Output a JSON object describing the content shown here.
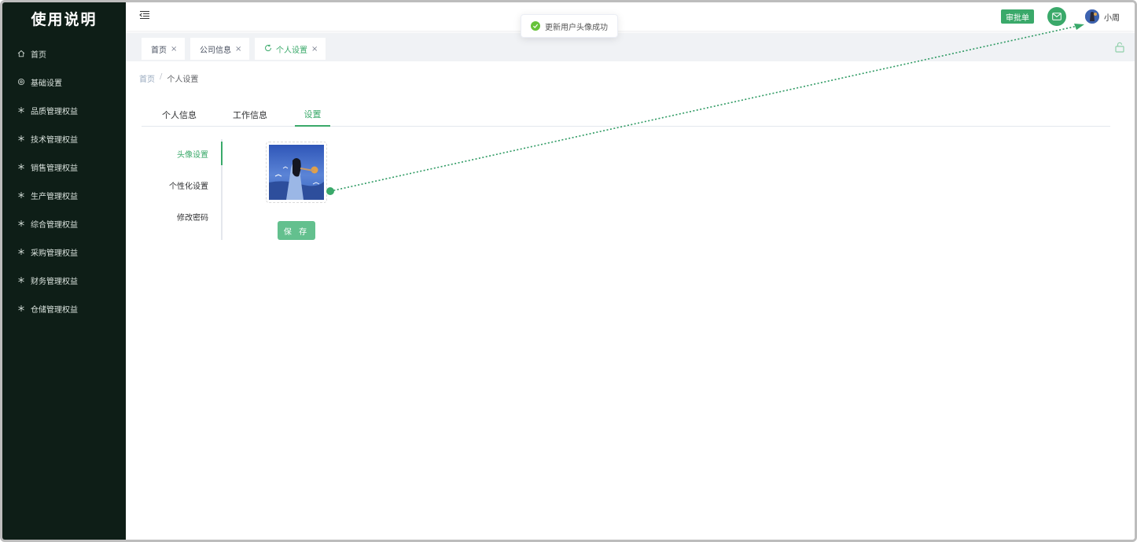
{
  "sidebar": {
    "title": "使用说明",
    "items": [
      {
        "label": "首页",
        "icon": "home-icon"
      },
      {
        "label": "基础设置",
        "icon": "settings-icon"
      },
      {
        "label": "品质管理权益",
        "icon": "asterisk-icon"
      },
      {
        "label": "技术管理权益",
        "icon": "asterisk-icon"
      },
      {
        "label": "销售管理权益",
        "icon": "asterisk-icon"
      },
      {
        "label": "生产管理权益",
        "icon": "asterisk-icon"
      },
      {
        "label": "综合管理权益",
        "icon": "asterisk-icon"
      },
      {
        "label": "采购管理权益",
        "icon": "asterisk-icon"
      },
      {
        "label": "财务管理权益",
        "icon": "asterisk-icon"
      },
      {
        "label": "仓储管理权益",
        "icon": "asterisk-icon"
      }
    ]
  },
  "header": {
    "approve_label": "审批单",
    "user_name": "小周"
  },
  "toast": {
    "message": "更新用户头像成功",
    "status_color": "#67c23a"
  },
  "tags": [
    {
      "label": "首页",
      "active": false
    },
    {
      "label": "公司信息",
      "active": false
    },
    {
      "label": "个人设置",
      "active": true
    }
  ],
  "breadcrumb": {
    "home": "首页",
    "separator": "/",
    "current": "个人设置"
  },
  "top_tabs": [
    {
      "label": "个人信息",
      "active": false
    },
    {
      "label": "工作信息",
      "active": false
    },
    {
      "label": "设置",
      "active": true
    }
  ],
  "side_tabs": [
    {
      "label": "头像设置",
      "active": true
    },
    {
      "label": "个性化设置",
      "active": false
    },
    {
      "label": "修改密码",
      "active": false
    }
  ],
  "save_label": "保 存",
  "colors": {
    "accent": "#3aa96a",
    "sidebar_bg": "#0e1e17",
    "save_bg": "#63c08e"
  }
}
